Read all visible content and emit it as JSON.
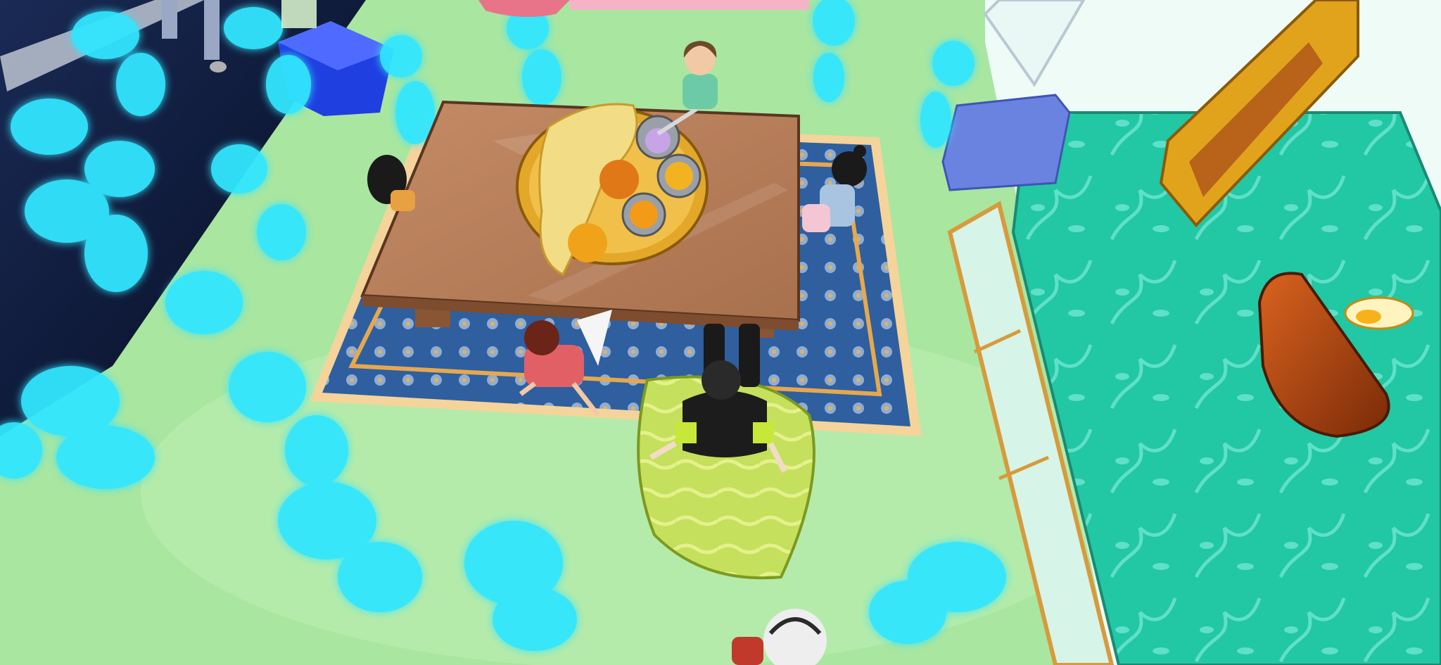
{
  "scene": {
    "description_visible_text": "",
    "colors": {
      "floor": "#a8e6a0",
      "wall_dark": "#0a1a3a",
      "glow": "#33e6ff",
      "table": "#b57a55",
      "rug": "#2e5c9a",
      "cushion": "#c7e05a",
      "bed": "#23c9a6",
      "lamp": "#b24a12",
      "frame": "#e2a31c"
    },
    "objects": [
      {
        "name": "low-table"
      },
      {
        "name": "food-platter"
      },
      {
        "name": "patterned-rug"
      },
      {
        "name": "green-floor-cushion"
      },
      {
        "name": "blue-floor-cushion"
      },
      {
        "name": "teal-bed"
      },
      {
        "name": "diya-oil-lamp"
      },
      {
        "name": "golden-wall-frame"
      },
      {
        "name": "glass-window"
      },
      {
        "name": "blue-cube"
      }
    ],
    "avatars": [
      {
        "name": "avatar-top"
      },
      {
        "name": "avatar-left"
      },
      {
        "name": "avatar-right"
      },
      {
        "name": "avatar-front-red"
      },
      {
        "name": "avatar-player"
      },
      {
        "name": "avatar-bottom-white-hair"
      },
      {
        "name": "avatar-topleft-legs"
      }
    ]
  }
}
